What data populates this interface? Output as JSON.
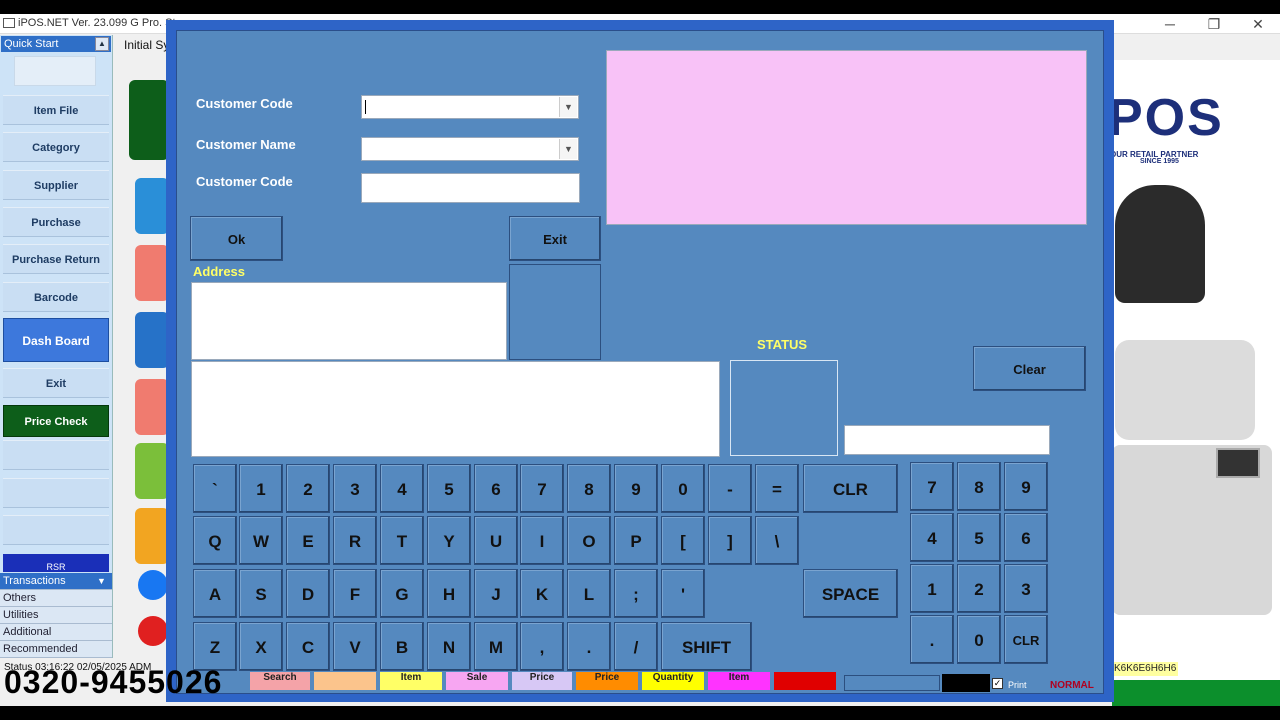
{
  "window": {
    "title": "iPOS.NET Ver. 23.099 G Pro. St",
    "min": "─",
    "max": "❐",
    "close": "✕"
  },
  "app": {
    "initial_tab": "Initial Sy",
    "status_line": "Status 03:16:22 02/05/2025 ADM",
    "phone": "0320-9455026",
    "hex_code": "K6K6E6H6H6",
    "logo": "POS",
    "logo_tagline": "OUR RETAIL PARTNER",
    "logo_since": "SINCE 1995"
  },
  "sidebar": {
    "header": "Quick Start",
    "items": [
      "Item File",
      "Category",
      "Supplier",
      "Purchase",
      "Purchase Return",
      "Barcode",
      "Dash Board",
      "Exit",
      "Price Check"
    ],
    "rsr": "RSR",
    "groups": [
      "Transactions",
      "Others",
      "Utilities",
      "Additional",
      "Recommended"
    ]
  },
  "dialog": {
    "customer_code_label": "Customer Code",
    "customer_name_label": "Customer Name",
    "customer_code2_label": "Customer Code",
    "customer_code_value": "",
    "customer_name_value": "",
    "customer_code2_value": "",
    "ok": "Ok",
    "exit": "Exit",
    "address_label": "Address",
    "status_label": "STATUS",
    "clear": "Clear"
  },
  "keyboard": {
    "row1": [
      "`",
      "1",
      "2",
      "3",
      "4",
      "5",
      "6",
      "7",
      "8",
      "9",
      "0",
      "-",
      "="
    ],
    "clr": "CLR",
    "row2": [
      "Q",
      "W",
      "E",
      "R",
      "T",
      "Y",
      "U",
      "I",
      "O",
      "P",
      "[",
      "]",
      "\\"
    ],
    "row3": [
      "A",
      "S",
      "D",
      "F",
      "G",
      "H",
      "J",
      "K",
      "L",
      ";",
      "'"
    ],
    "space": "SPACE",
    "row4": [
      "Z",
      "X",
      "C",
      "V",
      "B",
      "N",
      "M",
      ",",
      ".",
      "/"
    ],
    "shift": "SHIFT"
  },
  "numpad": {
    "keys": [
      "7",
      "8",
      "9",
      "4",
      "5",
      "6",
      "1",
      "2",
      "3",
      ".",
      "0"
    ],
    "clr": "CLR"
  },
  "bottom_strip": {
    "buttons": [
      {
        "label": "Search",
        "color": "#f4a3a8"
      },
      {
        "label": "",
        "color": "#fbc48c"
      },
      {
        "label": "Item",
        "color": "#ffff66"
      },
      {
        "label": "Sale",
        "color": "#f7a6f2"
      },
      {
        "label": "Price",
        "color": "#d7c8f5"
      },
      {
        "label": "Price",
        "color": "#ff8c00"
      },
      {
        "label": "Quantity",
        "color": "#ffff00"
      },
      {
        "label": "Item",
        "color": "#ff33ff"
      },
      {
        "label": "",
        "color": "#e00000"
      }
    ],
    "print": "Print",
    "mode": "NORMAL"
  }
}
